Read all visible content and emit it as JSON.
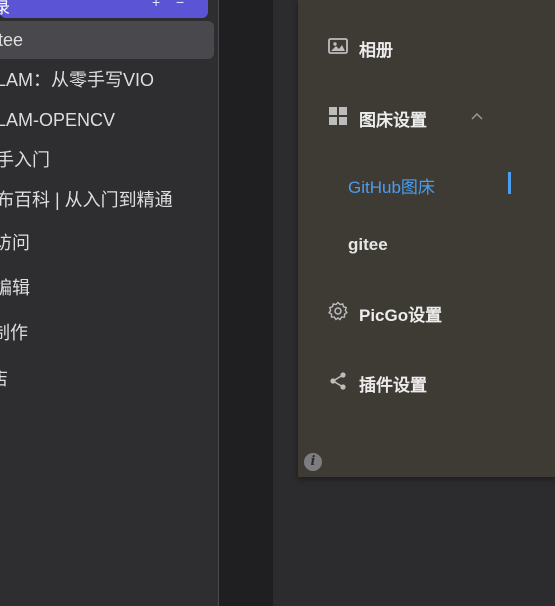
{
  "sidebar": {
    "active_header": {
      "label": "录",
      "ctl_add": "+",
      "ctl_remove": "−"
    },
    "items": [
      {
        "label": "tee"
      },
      {
        "label": "LAM：从零手写VIO"
      },
      {
        "label": "LAM-OPENCV"
      },
      {
        "label": "手入门"
      },
      {
        "label": "布百科 | 从入门到精通"
      },
      {
        "label": "访问"
      },
      {
        "label": "编辑"
      },
      {
        "label": "制作"
      },
      {
        "label": "店"
      }
    ]
  },
  "picgo": {
    "nav": [
      {
        "label": "相册",
        "icon": "image-icon"
      },
      {
        "label": "图床设置",
        "icon": "grid-icon",
        "expanded": true
      },
      {
        "label": "PicGo设置",
        "icon": "gear-icon"
      },
      {
        "label": "插件设置",
        "icon": "share-icon"
      }
    ],
    "submenu": [
      {
        "label": "GitHub图床",
        "active": true
      },
      {
        "label": "gitee",
        "active": false
      }
    ],
    "info_glyph": "i",
    "colors": {
      "accent": "#4a9df0",
      "panel": "#3e3b35",
      "header": "#5b55d6"
    }
  }
}
